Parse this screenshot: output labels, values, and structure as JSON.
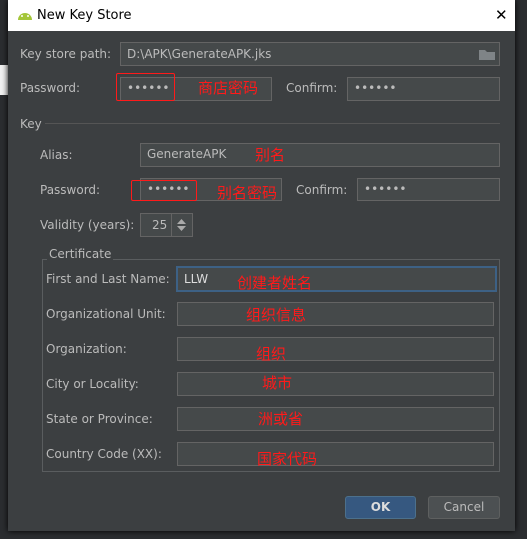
{
  "window": {
    "title": "New Key Store",
    "close": "✕"
  },
  "keystore": {
    "path_label": "Key store path:",
    "path_value": "D:\\APK\\GenerateAPK.jks",
    "password_label": "Password:",
    "password_value": "••••••",
    "confirm_label": "Confirm:",
    "confirm_value": "••••••"
  },
  "key": {
    "section_label": "Key",
    "alias_label": "Alias:",
    "alias_value": "GenerateAPK",
    "password_label": "Password:",
    "password_value": "••••••",
    "confirm_label": "Confirm:",
    "confirm_value": "••••••",
    "validity_label": "Validity (years):",
    "validity_value": "25"
  },
  "certificate": {
    "title": "Certificate",
    "fields": [
      {
        "label": "First and Last Name:",
        "value": "LLW"
      },
      {
        "label": "Organizational Unit:",
        "value": ""
      },
      {
        "label": "Organization:",
        "value": ""
      },
      {
        "label": "City or Locality:",
        "value": ""
      },
      {
        "label": "State or Province:",
        "value": ""
      },
      {
        "label": "Country Code (XX):",
        "value": ""
      }
    ]
  },
  "annotations": {
    "store_password": "商店密码",
    "alias": "别名",
    "alias_password": "别名密码",
    "name": "创建者姓名",
    "org_unit": "组织信息",
    "org": "组织",
    "city": "城市",
    "state": "洲或省",
    "country": "国家代码"
  },
  "buttons": {
    "ok": "OK",
    "cancel": "Cancel"
  },
  "colors": {
    "annotation": "#ff1a1a",
    "ok": "#365880",
    "focus": "#3d6185"
  }
}
